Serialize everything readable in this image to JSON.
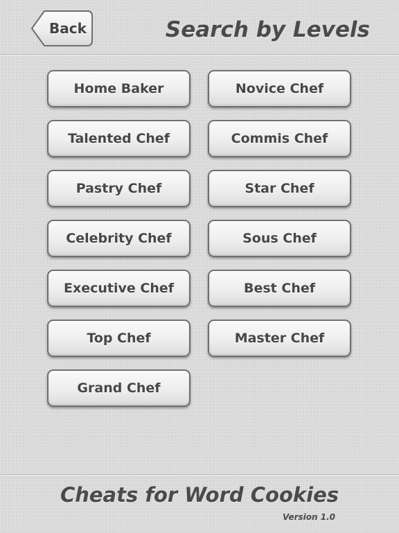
{
  "header": {
    "back_label": "Back",
    "title": "Search by Levels"
  },
  "levels": [
    {
      "label": "Home Baker"
    },
    {
      "label": "Novice Chef"
    },
    {
      "label": "Talented Chef"
    },
    {
      "label": "Commis Chef"
    },
    {
      "label": "Pastry Chef"
    },
    {
      "label": "Star Chef"
    },
    {
      "label": "Celebrity Chef"
    },
    {
      "label": "Sous Chef"
    },
    {
      "label": "Executive Chef"
    },
    {
      "label": "Best Chef"
    },
    {
      "label": "Top Chef"
    },
    {
      "label": "Master Chef"
    },
    {
      "label": "Grand Chef"
    }
  ],
  "footer": {
    "app_name": "Cheats for Word Cookies",
    "version": "Version 1.0"
  }
}
